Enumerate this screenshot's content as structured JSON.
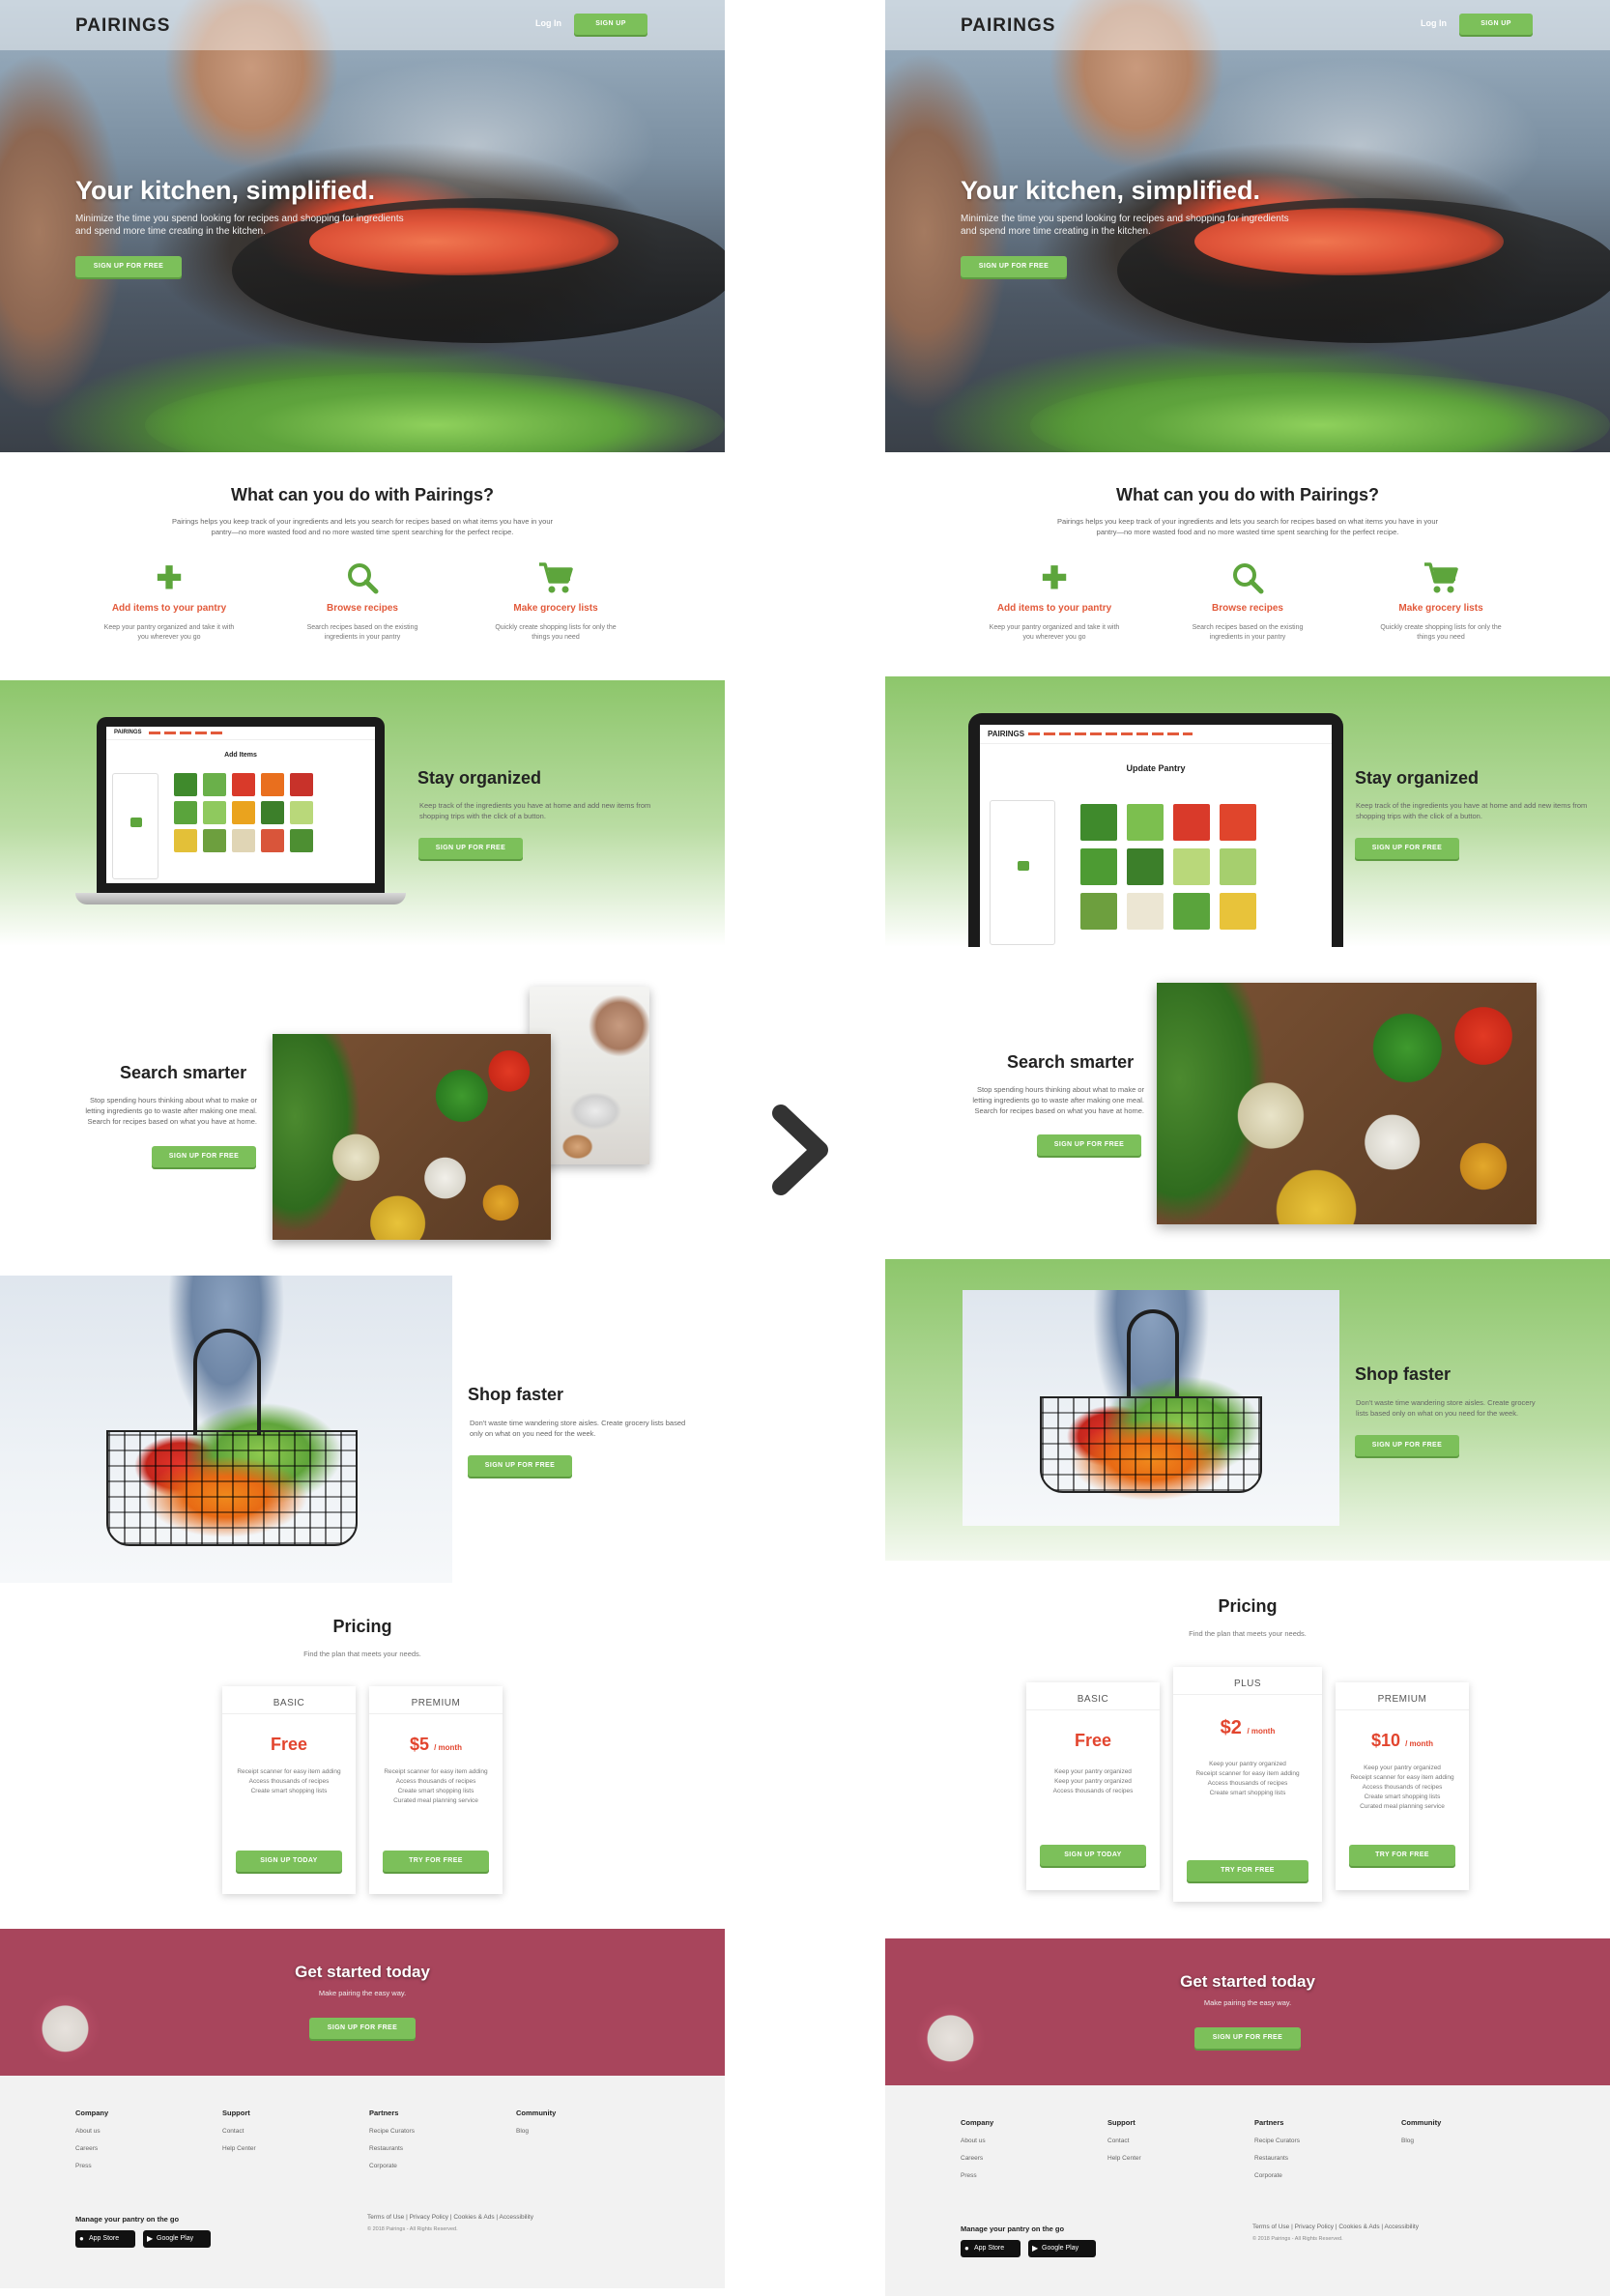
{
  "brand": "PAIRINGS",
  "colors": {
    "accent_green": "#7cc05a",
    "accent_red": "#e2452e",
    "icon_green": "#5da53c"
  },
  "nav": {
    "login": "Log In",
    "signup": "SIGN UP"
  },
  "hero": {
    "title": "Your kitchen, simplified.",
    "subtitle": "Minimize the time you spend looking for recipes and shopping for ingredients and spend more time creating in the kitchen.",
    "cta": "SIGN UP FOR FREE"
  },
  "what": {
    "title": "What can you do with Pairings?",
    "description": "Pairings helps you keep track of your ingredients and lets you search for recipes based on what items you have in your pantry—no more wasted food and no more wasted time spent searching for the perfect recipe.",
    "features": [
      {
        "icon": "plus-icon",
        "title": "Add items to your pantry",
        "desc": "Keep your pantry organized and take it with you wherever you go"
      },
      {
        "icon": "search-icon",
        "title": "Browse recipes",
        "desc": "Search recipes based on the existing ingredients in your pantry"
      },
      {
        "icon": "cart-icon",
        "title": "Make grocery lists",
        "desc": "Quickly create shopping lists for only the things you need"
      }
    ]
  },
  "stay": {
    "title": "Stay organized",
    "desc": "Keep track of the ingredients you have at home and add new items from shopping trips with the click of a button.",
    "cta": "SIGN UP FOR FREE",
    "mock_a_heading": "Add Items",
    "mock_b_heading": "Update Pantry",
    "mock_brand": "PAIRINGS"
  },
  "search": {
    "title": "Search smarter",
    "desc": "Stop spending hours thinking about what to make or letting ingredients go to waste after making one meal. Search for recipes based on what you have at home.",
    "cta": "SIGN UP FOR FREE"
  },
  "shop": {
    "title": "Shop faster",
    "desc_a": "Don't waste time wandering store aisles. Create grocery lists based only on what on you need for the week.",
    "desc_b": "Don't waste time wandering store aisles. Create grocery lists based only on what on you need for the week.",
    "cta": "SIGN UP FOR FREE"
  },
  "pricing": {
    "title": "Pricing",
    "subtitle": "Find the plan that meets your needs.",
    "basic": {
      "name": "BASIC",
      "price": "Free",
      "features_a": [
        "Receipt scanner for easy item adding",
        "Access thousands of recipes",
        "Create smart shopping lists"
      ],
      "features_b": [
        "Keep your pantry organized",
        "Keep your pantry organized",
        "Access thousands of recipes"
      ],
      "cta": "SIGN UP TODAY"
    },
    "plus": {
      "name": "PLUS",
      "price": "$2",
      "per": "/ month",
      "features": [
        "Keep your pantry organized",
        "Receipt scanner for easy item adding",
        "Access thousands of recipes",
        "Create smart shopping lists"
      ],
      "cta": "TRY FOR FREE"
    },
    "premium_a": {
      "name": "PREMIUM",
      "price": "$5",
      "per": "/ month",
      "features": [
        "Receipt scanner for easy item adding",
        "Access thousands of recipes",
        "Create smart shopping lists",
        "Curated meal planning service"
      ],
      "cta": "TRY FOR FREE"
    },
    "premium_b": {
      "name": "PREMIUM",
      "price": "$10",
      "per": "/ month",
      "features": [
        "Keep your pantry organized",
        "Receipt scanner for easy item adding",
        "Access thousands of recipes",
        "Create smart shopping lists",
        "Curated meal planning service"
      ],
      "cta": "TRY FOR FREE"
    }
  },
  "getstarted": {
    "title": "Get started today",
    "subtitle": "Make pairing the easy way.",
    "cta": "SIGN UP FOR FREE"
  },
  "footer": {
    "columns": [
      {
        "title": "Company",
        "links": [
          "About us",
          "Careers",
          "Press"
        ]
      },
      {
        "title": "Support",
        "links": [
          "Contact",
          "Help Center"
        ]
      },
      {
        "title": "Partners",
        "links": [
          "Recipe Curators",
          "Restaurants",
          "Corporate"
        ]
      },
      {
        "title": "Community",
        "links": [
          "Blog"
        ]
      }
    ],
    "manage": "Manage your pantry on the go",
    "app_store": "App Store",
    "google_play": "Google Play",
    "legal": "Terms of Use | Privacy Policy | Cookies & Ads | Accessibility",
    "copyright": "© 2018 Pairings - All Rights Reserved."
  }
}
